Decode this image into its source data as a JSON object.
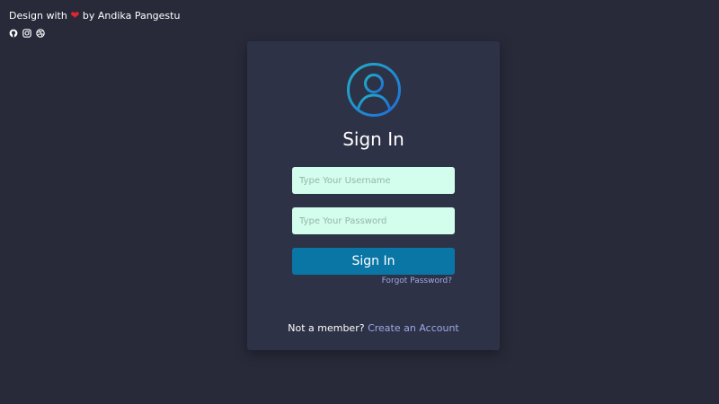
{
  "credit": {
    "prefix": "Design with",
    "heart": "❤",
    "suffix": "by Andika Pangestu"
  },
  "social": [
    "github-icon",
    "instagram-icon",
    "dribbble-icon"
  ],
  "card": {
    "title": "Sign In",
    "username_placeholder": "Type Your Username",
    "password_placeholder": "Type Your Password",
    "submit_label": "Sign In",
    "forgot_label": "Forgot Password?",
    "member_text": "Not a member?",
    "create_label": "Create an Account"
  },
  "colors": {
    "background": "#282a3a",
    "card": "#2e3246",
    "input": "#d3fdec",
    "button": "#0a76a6",
    "link": "#9ea8e6",
    "heart": "#e0262f",
    "avatar_gradient_start": "#20b0c8",
    "avatar_gradient_end": "#1f6ed8"
  }
}
